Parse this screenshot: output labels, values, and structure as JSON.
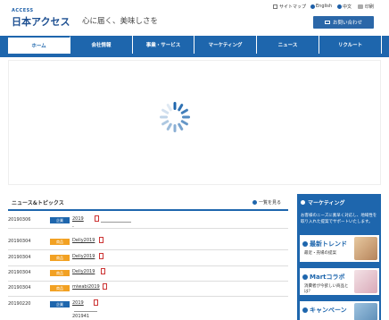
{
  "header": {
    "logo_small": "ACCESS",
    "logo_main": "日本アクセス",
    "tagline": "心に届く、美味しさを",
    "util": {
      "sitemap": "サイトマップ",
      "english": "English",
      "chinese": "中文",
      "print": "印刷"
    },
    "contact_label": "お問い合わせ"
  },
  "nav": {
    "items": [
      {
        "label": "ホーム"
      },
      {
        "label": "会社情報"
      },
      {
        "label": "事業・サービス"
      },
      {
        "label": "マーケティング"
      },
      {
        "label": "ニュース"
      },
      {
        "label": "リクルート"
      }
    ]
  },
  "news": {
    "title": "ニュース&トピックス",
    "more": "一覧を見る",
    "rows": [
      {
        "date": "20190306",
        "badge": "企業",
        "link": "2019",
        "extra": "-"
      },
      {
        "date": "20190304",
        "badge": "商品",
        "link": "Deliy2019"
      },
      {
        "date": "20190304",
        "badge": "商品",
        "link": "Deliy2019"
      },
      {
        "date": "20190304",
        "badge": "商品",
        "link": "Deliy2019"
      },
      {
        "date": "20190304",
        "badge": "商品",
        "link": "miwabi2019"
      },
      {
        "date": "20190220",
        "badge": "企業",
        "link": "2019",
        "extra": "201941"
      }
    ],
    "colors": {
      "corporate": "#1e66ad",
      "product": "#f2a123"
    }
  },
  "side": {
    "title": "マーケティング",
    "desc": "お客様のニーズに素早く対応し、地域性を取り入れた提案でサポートいたします。",
    "cards": [
      {
        "title": "最新トレンド",
        "sub": "最近・売場の提案"
      },
      {
        "title": "Martコラボ",
        "sub": "消費者が今欲しい商品とは？"
      },
      {
        "title": "キャンペーン",
        "sub": ""
      }
    ]
  },
  "colors": {
    "brand": "#1e66ad",
    "accent": "#f2a123"
  }
}
